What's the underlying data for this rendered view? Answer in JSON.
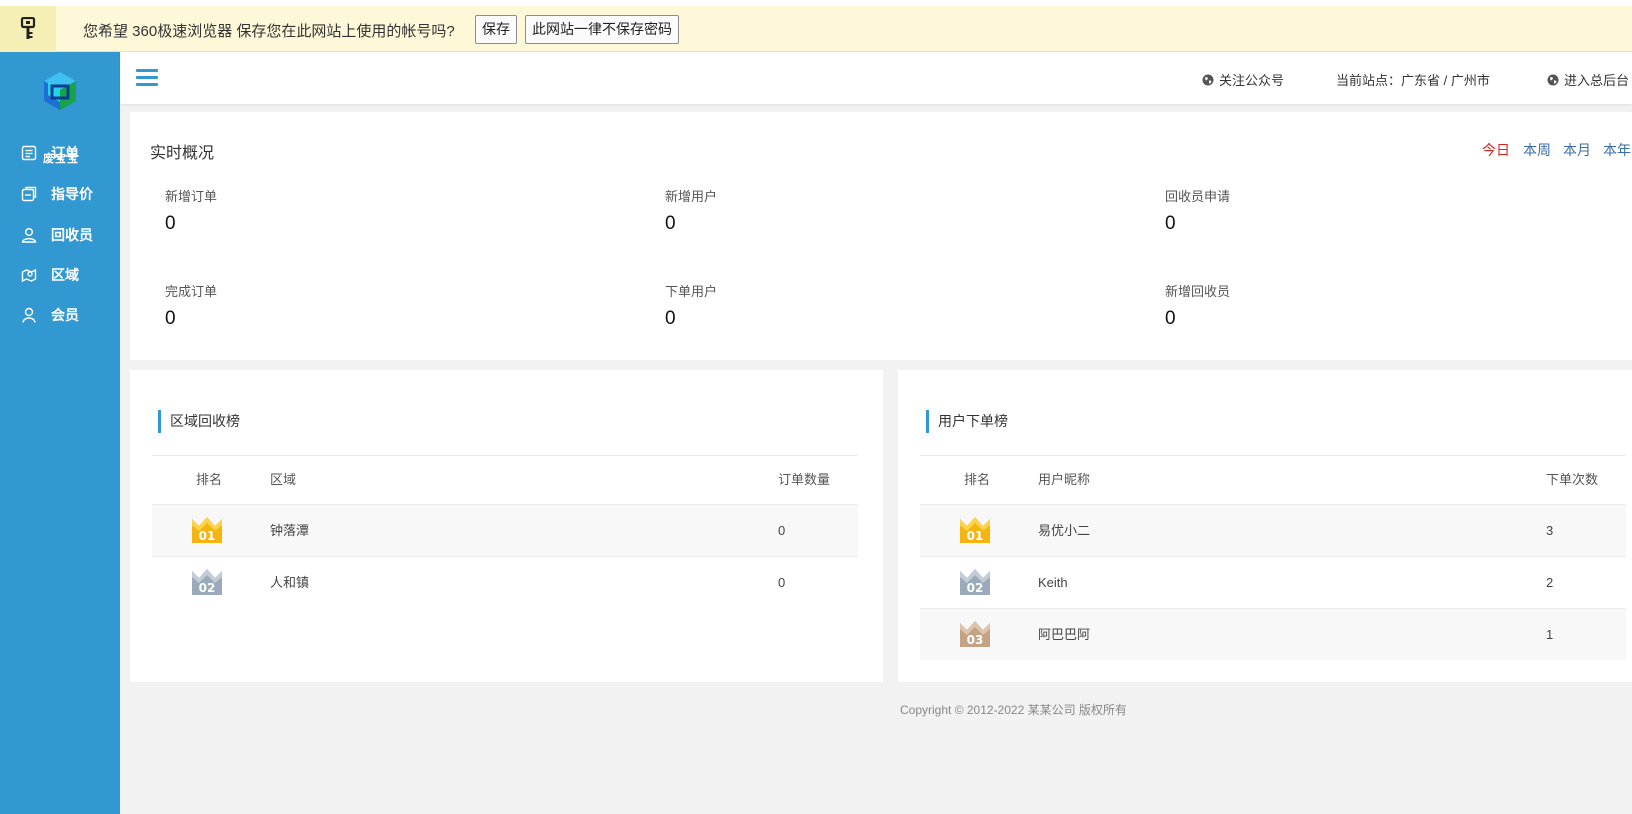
{
  "password_bar": {
    "prompt": "您希望 360极速浏览器 保存您在此网站上使用的帐号吗?",
    "save_label": "保存",
    "never_label": "此网站一律不保存密码"
  },
  "sidebar": {
    "logo_text": "废宝宝",
    "items": [
      {
        "label": "订单",
        "icon": "list-icon"
      },
      {
        "label": "指导价",
        "icon": "price-tag-icon"
      },
      {
        "label": "回收员",
        "icon": "user-icon"
      },
      {
        "label": "区域",
        "icon": "map-icon"
      },
      {
        "label": "会员",
        "icon": "member-icon"
      }
    ]
  },
  "header": {
    "follow_label": "关注公众号",
    "current_site": "当前站点：广东省 / 广州市",
    "admin_label": "进入总后台"
  },
  "overview": {
    "title": "实时概况",
    "ranges": [
      "今日",
      "本周",
      "本月",
      "本年"
    ],
    "active_range": "今日",
    "stats": [
      {
        "label": "新增订单",
        "value": "0"
      },
      {
        "label": "新增用户",
        "value": "0"
      },
      {
        "label": "回收员申请",
        "value": "0"
      },
      {
        "label": "完成订单",
        "value": "0"
      },
      {
        "label": "下单用户",
        "value": "0"
      },
      {
        "label": "新增回收员",
        "value": "0"
      }
    ]
  },
  "region_rank": {
    "title": "区域回收榜",
    "columns": [
      "排名",
      "区域",
      "订单数量"
    ],
    "rows": [
      {
        "rank": "01",
        "name": "钟落潭",
        "count": "0"
      },
      {
        "rank": "02",
        "name": "人和镇",
        "count": "0"
      }
    ]
  },
  "user_rank": {
    "title": "用户下单榜",
    "columns": [
      "排名",
      "用户昵称",
      "下单次数"
    ],
    "rows": [
      {
        "rank": "01",
        "name": "易优小二",
        "count": "3"
      },
      {
        "rank": "02",
        "name": "Keith",
        "count": "2"
      },
      {
        "rank": "03",
        "name": "阿巴巴阿",
        "count": "1"
      }
    ]
  },
  "colors": {
    "sidebar": "#3298d1",
    "active_range": "#e0231b",
    "gold": "#f5b40f",
    "silver": "#9aaabb",
    "bronze": "#c4a385"
  },
  "footer": {
    "copyright": "Copyright © 2012-2022 某某公司 版权所有"
  }
}
